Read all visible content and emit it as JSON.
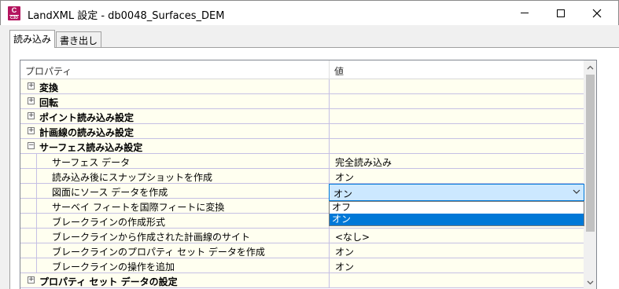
{
  "window": {
    "title": "LandXML 設定 - db0048_Surfaces_DEM",
    "icon_letter": "C",
    "icon_sub": "C3D"
  },
  "tabs": [
    {
      "label": "読み込み",
      "active": true
    },
    {
      "label": "書き出し",
      "active": false
    }
  ],
  "grid": {
    "headers": {
      "property": "プロパティ",
      "value": "値"
    },
    "rows": [
      {
        "type": "category",
        "expander": "+",
        "label": "変換",
        "value": ""
      },
      {
        "type": "category",
        "expander": "+",
        "label": "回転",
        "value": ""
      },
      {
        "type": "category",
        "expander": "+",
        "label": "ポイント読み込み設定",
        "value": ""
      },
      {
        "type": "category",
        "expander": "+",
        "label": "計画線の読み込み設定",
        "value": ""
      },
      {
        "type": "category",
        "expander": "−",
        "label": "サーフェス読み込み設定",
        "value": ""
      },
      {
        "type": "child",
        "label": "サーフェス データ",
        "value": "完全読み込み"
      },
      {
        "type": "child",
        "label": "読み込み後にスナップショットを作成",
        "value": "オン"
      },
      {
        "type": "child",
        "label": "図面にソース データを作成",
        "value": "オン"
      },
      {
        "type": "child",
        "label": "サーベイ フィートを国際フィートに変換",
        "value": ""
      },
      {
        "type": "child",
        "label": "ブレークラインの作成形式",
        "value": ""
      },
      {
        "type": "child",
        "label": "ブレークラインから作成された計画線のサイト",
        "value": "<なし>"
      },
      {
        "type": "child",
        "label": "ブレークラインのプロパティ セット データを作成",
        "value": "オン"
      },
      {
        "type": "child",
        "label": "ブレークラインの操作を追加",
        "value": "オン"
      },
      {
        "type": "category",
        "expander": "+",
        "label": "プロパティ セット データの設定",
        "value": ""
      }
    ]
  },
  "combo": {
    "value": "オン",
    "options": [
      "オフ",
      "オン"
    ],
    "highlighted": "オン"
  },
  "colors": {
    "row_bg": "#fffff0",
    "grid_line": "#c5c0e4",
    "selection": "#0078d7",
    "combo_bg": "#cce8ff",
    "icon_bg": "#b4155f"
  }
}
